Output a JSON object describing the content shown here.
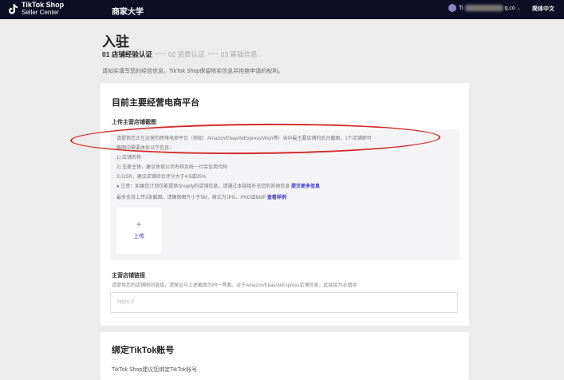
{
  "header": {
    "logo_line1": "TikTok Shop",
    "logo_line2": "Seller Center",
    "nav_title": "商家大学",
    "account_prefix": "Ti",
    "account_suffix": "q.co",
    "language": "简体中文"
  },
  "page": {
    "title": "入驻",
    "steps": [
      {
        "label": "01 店铺经验认证",
        "active": true
      },
      {
        "label": "02 资质认证",
        "active": false
      },
      {
        "label": "03 基础信息",
        "active": false
      }
    ],
    "intro": "请如实填写您的经验信息。TikTok Shop保留核实信息并拒绝申请的权利。"
  },
  "platform_card": {
    "title": "目前主要经营电商平台",
    "upload_label": "上传主营店铺截图",
    "requirements": [
      "请提供您正在运营的跨境电商平台（例如：Amazon/Ebay/AliExpress/Wish等）当中最主要店铺的后台截图，1个店铺即可",
      "截图中需要体现以下信息：",
      "1) 店铺名称",
      "2) 注册主体，建议体现公司名称及统一社会信用代码",
      "3) DSR，建议店铺综合评分大于4.5或95%",
      "● 注意：如果您计划仅能提供Shopify的店铺信息，请通过本链接补充您的其他信息",
      "最多支持上传3张截图。请确保图片小于5M，格式为JPG、PNG或BMP"
    ],
    "more_info_link": "提交更多信息",
    "example_link": "查看样例",
    "upload_plus": "+",
    "upload_button": "上传",
    "link_label": "主营店铺链接",
    "link_help": "请提供您的店铺网站链接，请保证与上述截图为同一界面。对于Amazon/Ebay/AliExpress店铺信息，此链接为必填项",
    "link_placeholder": "https://"
  },
  "tiktok_card": {
    "title": "绑定TikTok账号",
    "subtitle": "TikTok Shop建议您绑定TikTok账号"
  },
  "colors": {
    "header_bg": "#0d0d26",
    "page_bg": "#ececec",
    "link": "#3a34c8",
    "annotation": "#d42a2a"
  },
  "icons": {
    "logo": "tiktok-note-icon",
    "avatar": "user-avatar",
    "dropdown": "chevron-down-icon",
    "upload": "plus-icon"
  }
}
